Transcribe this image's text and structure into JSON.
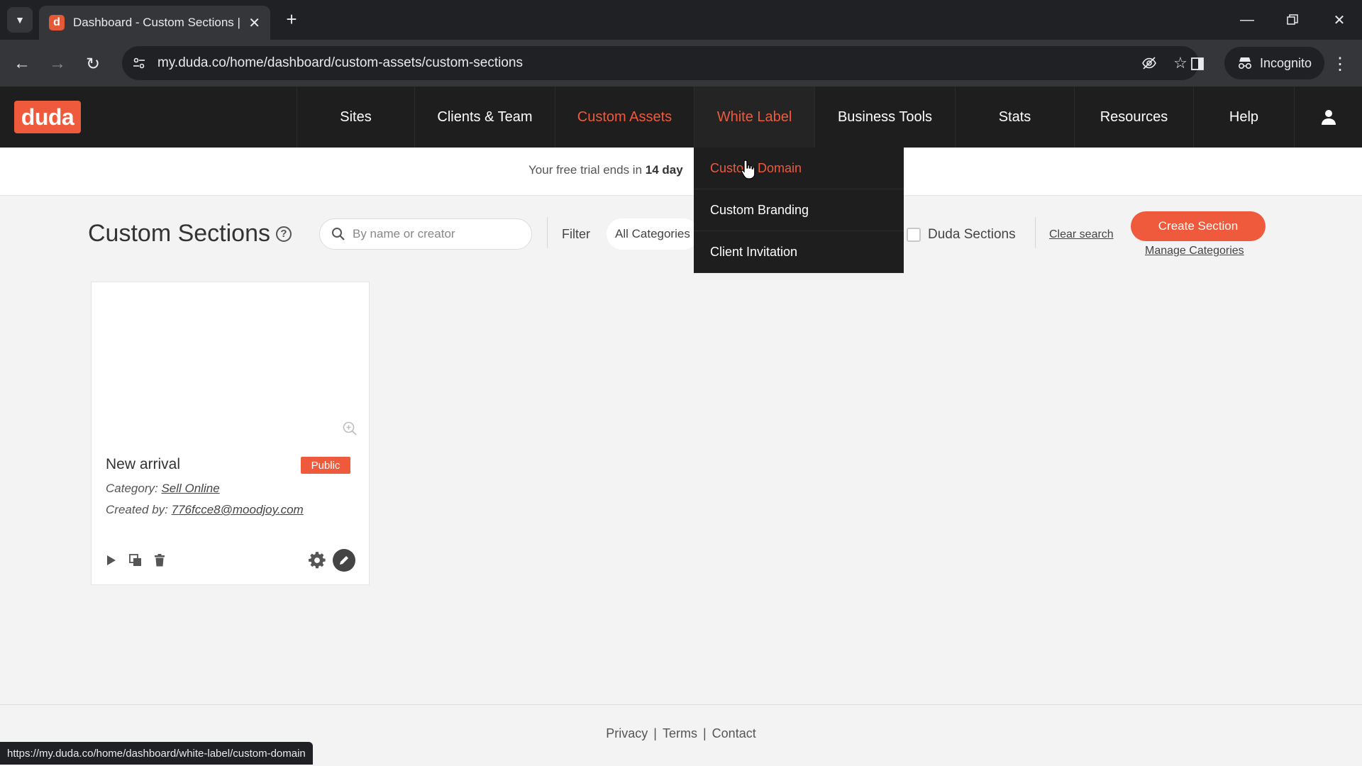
{
  "browser": {
    "tab_title": "Dashboard - Custom Sections |",
    "tab_favicon_letter": "d",
    "url": "my.duda.co/home/dashboard/custom-assets/custom-sections",
    "incognito_label": "Incognito",
    "status_url": "https://my.duda.co/home/dashboard/white-label/custom-domain"
  },
  "header": {
    "logo": "duda",
    "nav": [
      {
        "label": "Sites"
      },
      {
        "label": "Clients & Team"
      },
      {
        "label": "Custom Assets",
        "active": true
      },
      {
        "label": "White Label",
        "open": true
      },
      {
        "label": "Business Tools"
      },
      {
        "label": "Stats"
      },
      {
        "label": "Resources"
      },
      {
        "label": "Help"
      }
    ]
  },
  "white_label_menu": {
    "items": [
      {
        "label": "Custom Domain",
        "hover": true
      },
      {
        "label": "Custom Branding"
      },
      {
        "label": "Client Invitation"
      }
    ]
  },
  "banner": {
    "prefix": "Your free trial ends in ",
    "days": "14 day"
  },
  "toolbar": {
    "title": "Custom Sections",
    "help_icon": "?",
    "search_placeholder": "By name or creator",
    "filter_label": "Filter",
    "category_value": "All Categories",
    "duda_sections_label": "Duda Sections",
    "clear_search": "Clear search",
    "create_button": "Create Section",
    "manage_categories": "Manage Categories"
  },
  "card": {
    "name": "New arrival",
    "badge": "Public",
    "category_label": "Category:",
    "category_value": "Sell Online",
    "created_label": "Created by:",
    "created_value": "776fcce8@moodjoy.com"
  },
  "footer": {
    "links": [
      "Privacy",
      "Terms",
      "Contact"
    ]
  },
  "colors": {
    "accent": "#ef5a3c",
    "nav_bg": "#1e1e1e",
    "page_bg": "#f3f3f3"
  }
}
